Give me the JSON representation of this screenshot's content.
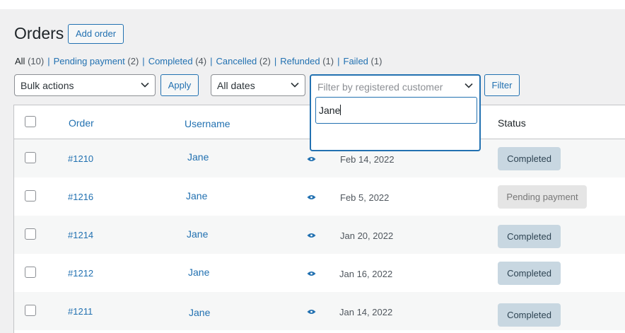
{
  "page": {
    "title": "Orders",
    "add_button": "Add order"
  },
  "filters_nav": [
    {
      "label": "All",
      "count": "(10)",
      "current": true
    },
    {
      "label": "Pending payment",
      "count": "(2)",
      "current": false
    },
    {
      "label": "Completed",
      "count": "(4)",
      "current": false
    },
    {
      "label": "Cancelled",
      "count": "(2)",
      "current": false
    },
    {
      "label": "Refunded",
      "count": "(1)",
      "current": false
    },
    {
      "label": "Failed",
      "count": "(1)",
      "current": false
    }
  ],
  "toolbar": {
    "bulk_actions": "Bulk actions",
    "apply_label": "Apply",
    "dates": "All dates",
    "customer_placeholder": "Filter by registered customer",
    "customer_search_value": "Jane",
    "filter_label": "Filter"
  },
  "table": {
    "columns": {
      "order": "Order",
      "username": "Username",
      "status": "Status"
    },
    "rows": [
      {
        "order": "#1210",
        "username": "Jane",
        "date": "Feb 14, 2022",
        "status": "Completed",
        "status_type": "completed"
      },
      {
        "order": "#1216",
        "username": "Jane",
        "date": "Feb 5, 2022",
        "status": "Pending payment",
        "status_type": "pending"
      },
      {
        "order": "#1214",
        "username": "Jane",
        "date": "Jan 20, 2022",
        "status": "Completed",
        "status_type": "completed"
      },
      {
        "order": "#1212",
        "username": "Jane",
        "date": "Jan 16, 2022",
        "status": "Completed",
        "status_type": "completed"
      },
      {
        "order": "#1211",
        "username": "Jane",
        "date": "Jan 14, 2022",
        "status": "Completed",
        "status_type": "completed"
      }
    ]
  },
  "colors": {
    "accent": "#2271b1",
    "completed_bg": "#c8d7e1",
    "pending_bg": "#e5e5e5"
  },
  "icons": {
    "row_preview": "eye-icon",
    "select_arrow": "chevron-down-icon"
  }
}
